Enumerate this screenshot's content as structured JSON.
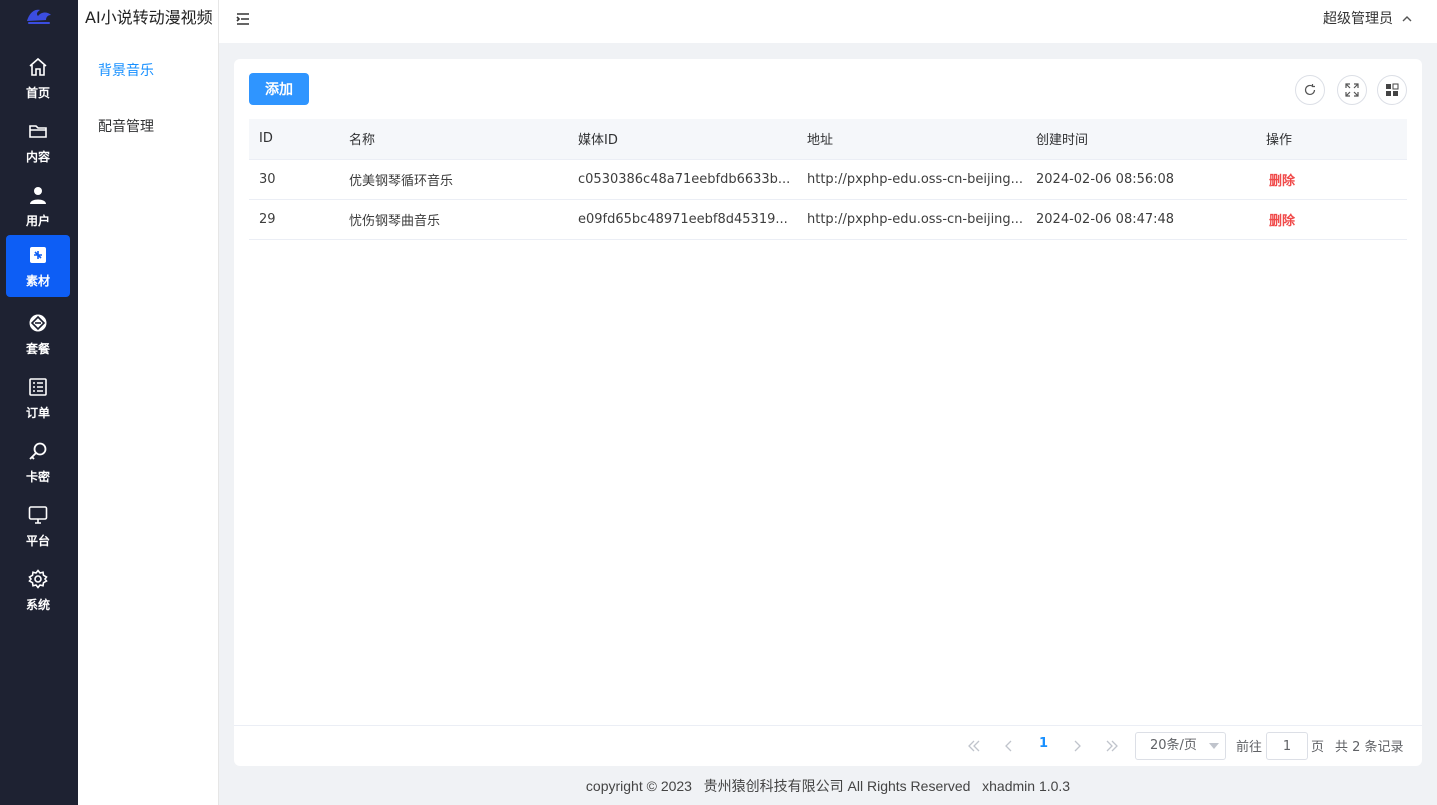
{
  "app": {
    "title": "AI小说转动漫视频"
  },
  "rail": {
    "items": [
      {
        "label": "首页",
        "icon": "home-icon"
      },
      {
        "label": "内容",
        "icon": "folder-icon"
      },
      {
        "label": "用户",
        "icon": "user-icon"
      },
      {
        "label": "素材",
        "icon": "material-icon",
        "active": true
      },
      {
        "label": "套餐",
        "icon": "package-icon"
      },
      {
        "label": "订单",
        "icon": "order-icon"
      },
      {
        "label": "卡密",
        "icon": "key-icon"
      },
      {
        "label": "平台",
        "icon": "monitor-icon"
      },
      {
        "label": "系统",
        "icon": "gear-icon"
      }
    ]
  },
  "submenu": {
    "items": [
      {
        "label": "背景音乐",
        "active": true
      },
      {
        "label": "配音管理",
        "active": false
      }
    ]
  },
  "header": {
    "user": "超级管理员"
  },
  "toolbar": {
    "add_label": "添加"
  },
  "table": {
    "columns": [
      "ID",
      "名称",
      "媒体ID",
      "地址",
      "创建时间",
      "操作"
    ],
    "rows": [
      {
        "id": "30",
        "name": "优美钢琴循环音乐",
        "media_id": "c0530386c48a71eebfdb6633b...",
        "url": "http://pxphp-edu.oss-cn-beijing...",
        "created": "2024-02-06 08:56:08",
        "action": "删除"
      },
      {
        "id": "29",
        "name": "忧伤钢琴曲音乐",
        "media_id": "e09fd65bc48971eebf8d45319...",
        "url": "http://pxphp-edu.oss-cn-beijing...",
        "created": "2024-02-06 08:47:48",
        "action": "删除"
      }
    ]
  },
  "pagination": {
    "current_page": "1",
    "page_size": "20条/页",
    "goto_prefix": "前往",
    "goto_value": "1",
    "goto_suffix": "页",
    "total": "共 2 条记录"
  },
  "footer": {
    "text": "copyright © 2023   贵州猿创科技有限公司 All Rights Reserved   xhadmin 1.0.3"
  },
  "colors": {
    "rail_bg": "#1e2232",
    "active": "#0d5ef5",
    "primary": "#2f95ff",
    "danger": "#f04a4a"
  }
}
